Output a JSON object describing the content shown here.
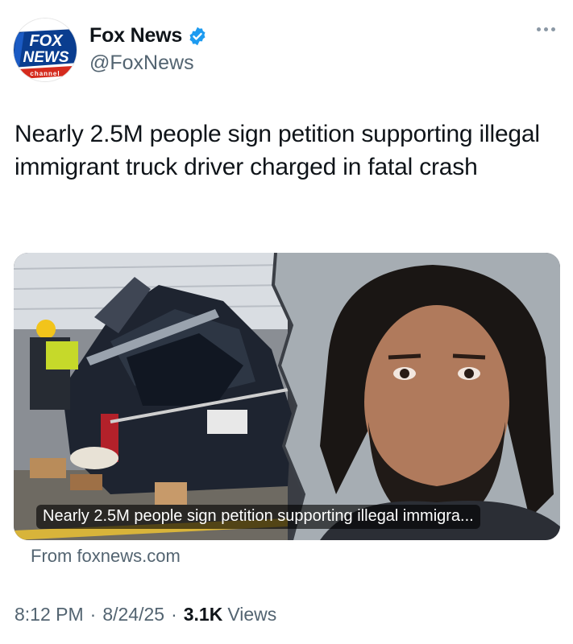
{
  "author": {
    "display_name": "Fox News",
    "handle": "@FoxNews",
    "avatar_logo_text": [
      "FOX",
      "NEWS",
      "channel"
    ],
    "verified_color": "#1d9bf0"
  },
  "tweet": {
    "text": "Nearly 2.5M people sign petition supporting illegal immigrant truck driver charged in fatal crash"
  },
  "link_card": {
    "caption": "Nearly 2.5M people sign petition supporting illegal immigra...",
    "source": "From foxnews.com"
  },
  "meta": {
    "time": "8:12 PM",
    "date": "8/24/25",
    "views_count": "3.1K",
    "views_label": "Views",
    "separator": "·"
  },
  "icons": {
    "more": "more-horizontal-icon",
    "verified": "verified-badge-icon"
  },
  "colors": {
    "text_primary": "#0f1419",
    "text_secondary": "#536471",
    "fox_blue": "#0a3d8f",
    "fox_red": "#d52b1e"
  }
}
